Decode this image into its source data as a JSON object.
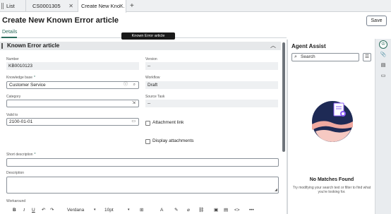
{
  "tabs": [
    {
      "label": "List"
    },
    {
      "label": "CS0001305"
    },
    {
      "label": "Create New Kno..."
    }
  ],
  "page": {
    "title": "Create New Known Error article",
    "save_label": "Save",
    "tooltip": "Known Error article",
    "subtab": "Details"
  },
  "section": {
    "title": "Known Error article"
  },
  "form": {
    "number": {
      "label": "Number",
      "value": "KB0010123"
    },
    "version": {
      "label": "Version",
      "value": "--"
    },
    "knowledge_base": {
      "label": "Knowledge base",
      "value": "Customer Service"
    },
    "workflow": {
      "label": "Workflow",
      "value": "Draft"
    },
    "category": {
      "label": "Category",
      "value": ""
    },
    "source_task": {
      "label": "Source Task",
      "value": "--"
    },
    "valid_to": {
      "label": "Valid to",
      "value": "2100-01-01"
    },
    "attachment_link": {
      "label": "Attachment link",
      "checked": false
    },
    "display_attachments": {
      "label": "Display attachments",
      "checked": false
    },
    "short_description": {
      "label": "Short description",
      "value": ""
    },
    "description": {
      "label": "Description",
      "value": ""
    },
    "workaround": {
      "label": "Workaround"
    },
    "required_marker": "*"
  },
  "editor_toolbar": {
    "bold": "B",
    "italic": "I",
    "underline": "U",
    "font": "Verdana",
    "size": "10pt",
    "more": "•••"
  },
  "agent_assist": {
    "title": "Agent Assist",
    "search_placeholder": "Search",
    "no_matches_title": "No Matches Found",
    "no_matches_hint": "Try modifying your search text or filter to find what you're looking for."
  },
  "colors": {
    "accent": "#2b6c5c",
    "readonly_bg": "#eef0f2",
    "illustration_circle": "#1e2a55",
    "illustration_pink": "#f0a9a0",
    "illustration_accent": "#8b5cf6"
  }
}
